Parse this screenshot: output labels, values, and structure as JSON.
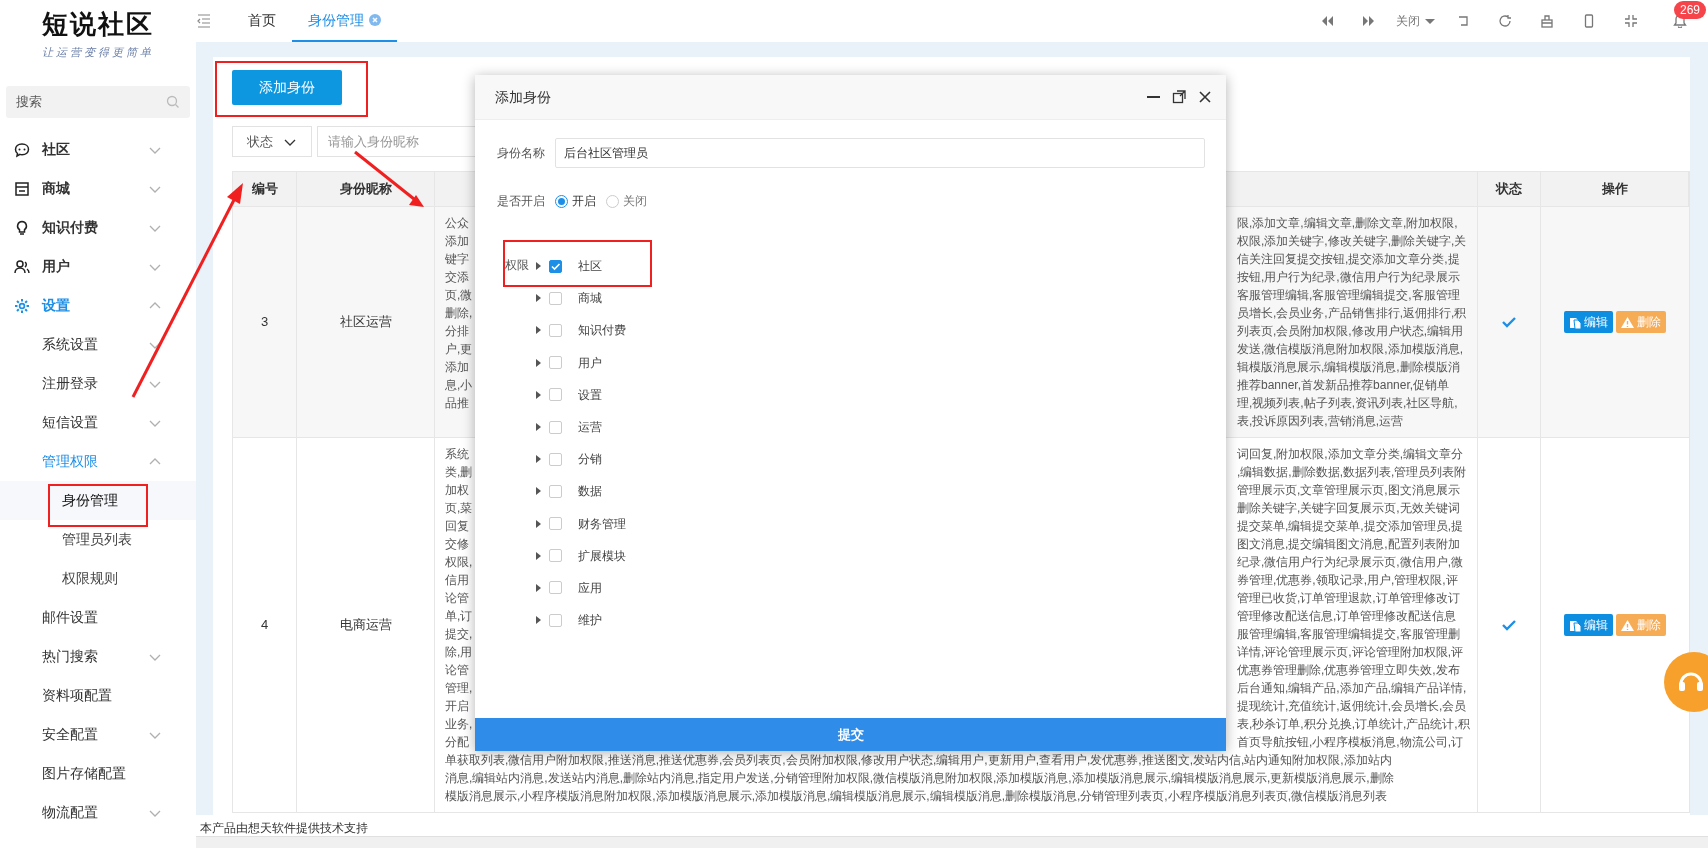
{
  "sidebar": {
    "logo": "短说社区",
    "slogan": "让运营变得更简单",
    "search": {
      "placeholder": "搜索"
    },
    "menu": [
      {
        "label": "社区",
        "kind": "group",
        "expanded": false,
        "active": false
      },
      {
        "label": "商城",
        "kind": "group",
        "expanded": false,
        "active": false
      },
      {
        "label": "知识付费",
        "kind": "group",
        "expanded": false,
        "active": false
      },
      {
        "label": "用户",
        "kind": "group",
        "expanded": false,
        "active": false
      },
      {
        "label": "设置",
        "kind": "group",
        "expanded": true,
        "active": true,
        "children": [
          {
            "label": "系统设置",
            "kind": "group",
            "expanded": false,
            "active": false
          },
          {
            "label": "注册登录",
            "kind": "group",
            "expanded": false,
            "active": false
          },
          {
            "label": "短信设置",
            "kind": "group",
            "expanded": false,
            "active": false
          },
          {
            "label": "管理权限",
            "kind": "group",
            "expanded": true,
            "active": true,
            "children": [
              {
                "label": "身份管理",
                "selected": true
              },
              {
                "label": "管理员列表",
                "selected": false
              },
              {
                "label": "权限规则",
                "selected": false
              }
            ]
          },
          {
            "label": "邮件设置",
            "kind": "link"
          },
          {
            "label": "热门搜索",
            "kind": "group",
            "expanded": false,
            "active": false
          },
          {
            "label": "资料项配置",
            "kind": "link"
          },
          {
            "label": "安全配置",
            "kind": "group",
            "expanded": false,
            "active": false
          },
          {
            "label": "图片存储配置",
            "kind": "link"
          },
          {
            "label": "物流配置",
            "kind": "group",
            "expanded": false,
            "active": false
          }
        ]
      }
    ]
  },
  "tabs": [
    {
      "label": "首页",
      "selected": false,
      "closable": false
    },
    {
      "label": "身份管理",
      "selected": true,
      "closable": true
    }
  ],
  "toolbar": {
    "close_menu": "关闭",
    "notifications": "269"
  },
  "add_button": "添加身份",
  "filter": {
    "status": "状态",
    "placeholder": "请输入身份昵称"
  },
  "table": {
    "columns": [
      "编号",
      "身份昵称",
      "",
      "状态",
      "操作"
    ],
    "rows": [
      {
        "id": "3",
        "name": "社区运营",
        "enabled": true,
        "actions": [
          "编辑",
          "删除"
        ],
        "perm_left": [
          "公众",
          "添加",
          "键字",
          "交添",
          "页,微",
          "删除,",
          "分排",
          "户,更",
          "添加",
          "息,小",
          "品推"
        ],
        "perm_right": [
          "限,添加文章,编辑文章,删除文章,附加权限,",
          "权限,添加关键字,修改关键字,删除关键字,关",
          "信关注回复提交按钮,提交添加文章分类,提",
          "按钮,用户行为纪录,微信用户行为纪录展示",
          "客服管理编辑,客服管理编辑提交,客服管理",
          "员增长,会员业务,产品销售排行,返佣排行,积",
          "列表页,会员附加权限,修改用户状态,编辑用",
          "发送,微信模版消息附加权限,添加模版消息,",
          "辑模版消息展示,编辑模版消息,删除模版消",
          "推荐banner,首发新品推荐banner,促销单",
          "理,视频列表,帖子列表,资讯列表,社区导航,",
          "表,投诉原因列表,营销消息,运营"
        ]
      },
      {
        "id": "4",
        "name": "电商运营",
        "enabled": true,
        "actions": [
          "编辑",
          "删除"
        ],
        "perm_left": [
          "系统",
          "类,删",
          "加权",
          "页,菜",
          "回复",
          "交修",
          "权限,",
          "信用",
          "论管",
          "单,订",
          "提交,",
          "除,用",
          "论管",
          "管理,",
          "开启",
          "业务,",
          "分配"
        ],
        "perm_right": [
          "词回复,附加权限,添加文章分类,编辑文章分",
          ",编辑数据,删除数据,数据列表,管理员列表附",
          "管理展示页,文章管理展示页,图文消息展示",
          "删除关键字,关键字回复展示页,无效关键词",
          "提交菜单,编辑提交菜单,提交添加管理员,提",
          "图文消息,提交编辑图文消息,配置列表附加",
          "纪录,微信用户行为纪录展示页,微信用户,微",
          "券管理,优惠券,领取记录,用户,管理权限,评",
          "管理已收货,订单管理退款,订单管理修改订",
          "管理修改配送信息,订单管理修改配送信息",
          "服管理编辑,客服管理编辑提交,客服管理删",
          "详情,评论管理展示页,评论管理附加权限,评",
          "优惠券管理删除,优惠券管理立即失效,发布",
          "后台通知,编辑产品,添加产品,编辑产品详情,",
          "提现统计,充值统计,返佣统计,会员增长,会员",
          "表,秒杀订单,积分兑换,订单统计,产品统计,积",
          "首页导航按钮,小程序模板消息,物流公司,订"
        ],
        "perm_full": [
          "单获取列表,微信用户附加权限,推送消息,推送优惠券,会员列表页,会员附加权限,修改用户状态,编辑用户,更新用户,查看用户,发优惠券,推送图文,发站内信,站内通知附加权限,添加站内",
          "消息,编辑站内消息,发送站内消息,删除站内消息,指定用户发送,分销管理附加权限,微信模版消息附加权限,添加模版消息,添加模版消息展示,编辑模版消息展示,更新模版消息展示,删除",
          "模版消息展示,小程序模版消息附加权限,添加模版消息展示,添加模版消息,编辑模版消息展示,编辑模版消息,删除模版消息,分销管理列表页,小程序模版消息列表页,微信模版消息列表"
        ]
      }
    ]
  },
  "footer": "本产品由想天软件提供技术支持",
  "modal": {
    "title": "添加身份",
    "name_label": "身份名称",
    "name_value": "后台社区管理员",
    "open_label": "是否开启",
    "open_options": [
      {
        "label": "开启",
        "selected": true
      },
      {
        "label": "关闭",
        "selected": false
      }
    ],
    "perm_label": "权限",
    "tree": [
      {
        "label": "社区",
        "checked": true
      },
      {
        "label": "商城",
        "checked": false
      },
      {
        "label": "知识付费",
        "checked": false
      },
      {
        "label": "用户",
        "checked": false
      },
      {
        "label": "设置",
        "checked": false
      },
      {
        "label": "运营",
        "checked": false
      },
      {
        "label": "分销",
        "checked": false
      },
      {
        "label": "数据",
        "checked": false
      },
      {
        "label": "财务管理",
        "checked": false
      },
      {
        "label": "扩展模块",
        "checked": false
      },
      {
        "label": "应用",
        "checked": false
      },
      {
        "label": "维护",
        "checked": false
      }
    ],
    "submit": "提交"
  }
}
